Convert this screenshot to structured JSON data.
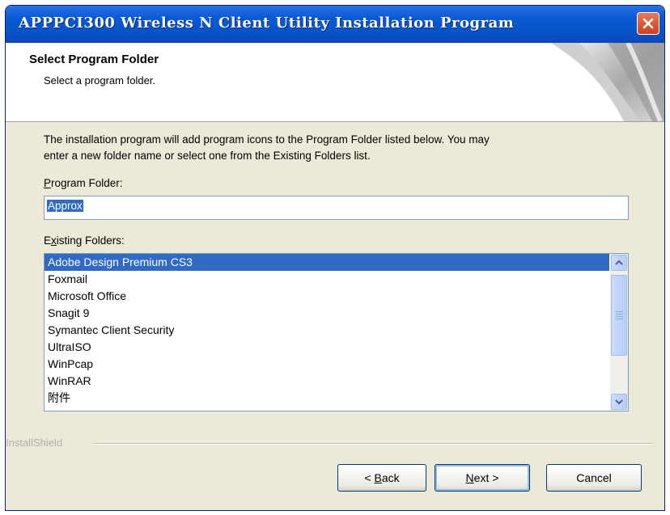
{
  "window": {
    "title": "APPPCI300 Wireless N Client Utility Installation Program"
  },
  "header": {
    "title": "Select Program Folder",
    "subtitle": "Select a program folder."
  },
  "main": {
    "intro_line1": "The installation program will add program icons to the Program Folder listed below. You may",
    "intro_line2": "enter a new folder name or select one from the Existing Folders list.",
    "program_folder_label_mnemonic": "P",
    "program_folder_label_rest": "rogram Folder:",
    "program_folder_value": "Approx",
    "existing_folders_label_pre": "E",
    "existing_folders_label_mnemonic": "x",
    "existing_folders_label_rest": "isting Folders:",
    "existing_folders": [
      "Adobe Design Premium CS3",
      "Foxmail",
      "Microsoft Office",
      "Snagit 9",
      "Symantec Client Security",
      "UltraISO",
      "WinPcap",
      "WinRAR",
      "附件"
    ],
    "selected_folder_index": 0
  },
  "footer": {
    "brand": "InstallShield",
    "back_mnemonic": "B",
    "back_rest": "ack",
    "next_mnemonic": "N",
    "next_rest": "ext",
    "cancel_label": "Cancel"
  },
  "colors": {
    "titlebar": "#0553c8",
    "selection": "#316ac5",
    "dialog_bg": "#ece9d8"
  },
  "icons": [
    "close-icon",
    "scroll-up-icon",
    "scroll-down-icon",
    "page-curl-icon"
  ]
}
